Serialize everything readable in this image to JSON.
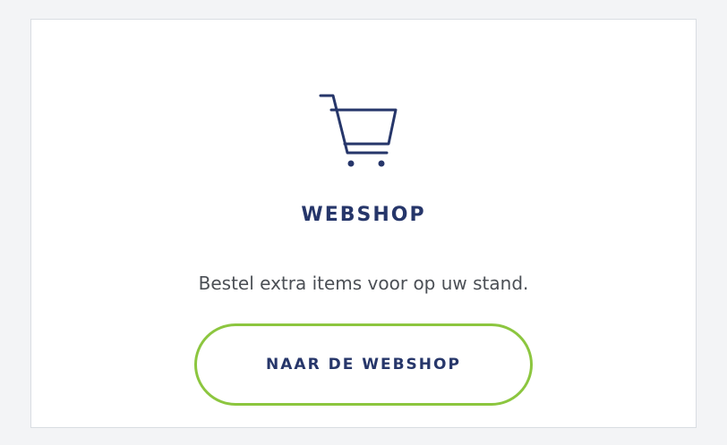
{
  "card": {
    "icon": "shopping-cart-icon",
    "title": "WEBSHOP",
    "description": "Bestel extra items voor op uw stand.",
    "button_label": "NAAR DE WEBSHOP"
  },
  "colors": {
    "primary_text": "#26366a",
    "body_text": "#4b4f55",
    "accent_border": "#8cc63f",
    "card_border": "#d9dde2",
    "page_background": "#f3f4f6"
  }
}
